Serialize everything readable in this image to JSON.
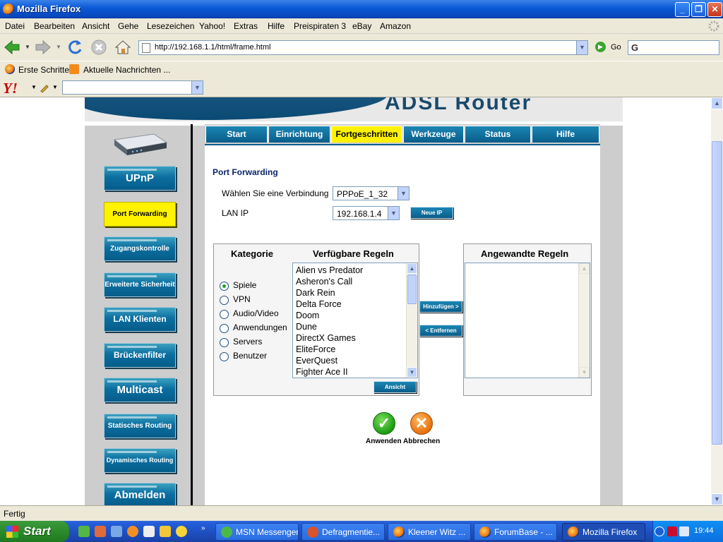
{
  "window": {
    "title": "Mozilla Firefox"
  },
  "menu": [
    "Datei",
    "Bearbeiten",
    "Ansicht",
    "Gehe",
    "Lesezeichen",
    "Yahoo!",
    "Extras",
    "Hilfe",
    "Preispiraten 3",
    "eBay",
    "Amazon"
  ],
  "nav": {
    "url": "http://192.168.1.1/html/frame.html",
    "go_label": "Go",
    "search_logo": "G"
  },
  "bookmarks": [
    "Erste Schritte",
    "Aktuelle Nachrichten ..."
  ],
  "yahoo": {
    "logo": "Y!"
  },
  "router": {
    "banner_title": "ADSL Router",
    "sidebar": [
      "UPnP",
      "Port Forwarding",
      "Zugangskontrolle",
      "Erweiterte Sicherheit",
      "LAN Klienten",
      "Brückenfilter",
      "Multicast",
      "Statisches Routing",
      "Dynamisches Routing",
      "Abmelden"
    ],
    "active_sidebar": "Port Forwarding",
    "tabs": [
      "Start",
      "Einrichtung",
      "Fortgeschritten",
      "Werkzeuge",
      "Status",
      "Hilfe"
    ],
    "active_tab": "Fortgeschritten",
    "page_title": "Port Forwarding",
    "connection_label": "Wählen Sie eine Verbindung",
    "connection_value": "PPPoE_1_32",
    "lan_ip_label": "LAN IP",
    "lan_ip_value": "192.168.1.4",
    "new_ip_button": "Neue IP",
    "category_header": "Kategorie",
    "available_header": "Verfügbare Regeln",
    "applied_header": "Angewandte Regeln",
    "categories": [
      "Spiele",
      "VPN",
      "Audio/Video",
      "Anwendungen",
      "Servers",
      "Benutzer"
    ],
    "selected_category": "Spiele",
    "available_rules": [
      "Alien vs Predator",
      "Asheron's Call",
      "Dark Rein",
      "Delta Force",
      "Doom",
      "Dune",
      "DirectX Games",
      "EliteForce",
      "EverQuest",
      "Fighter Ace II"
    ],
    "add_button": "Hinzufügen >",
    "remove_button": "< Entfernen",
    "view_button": "Ansicht",
    "apply_label": "Anwenden",
    "cancel_label": "Abbrechen"
  },
  "status": {
    "text": "Fertig"
  },
  "taskbar": {
    "start_label": "Start",
    "tasks": [
      "MSN Messenger",
      "Defragmentie...",
      "Kleener Witz ...",
      "ForumBase - ...",
      "Mozilla Firefox"
    ],
    "active_task": "Mozilla Firefox",
    "clock": "19:44"
  }
}
